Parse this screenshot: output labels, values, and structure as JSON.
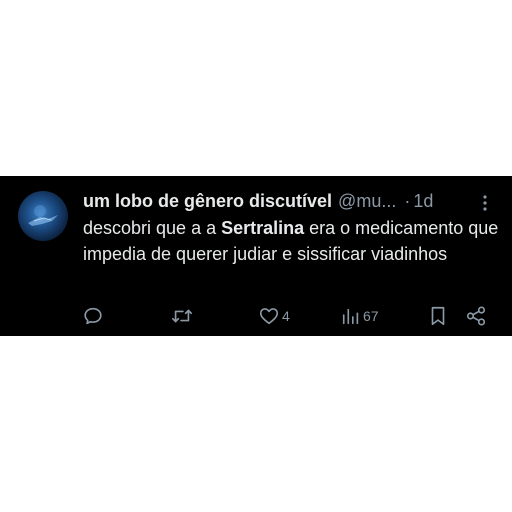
{
  "tweet": {
    "author_name": "um lobo de gênero discutível",
    "handle": "@mu...",
    "separator": "·",
    "time": "1d",
    "text_before": "descobri que a a ",
    "text_bold": "Sertralina",
    "text_after": " era o medicamento que impedia de querer judiar e sissificar viadinhos"
  },
  "actions": {
    "reply_icon": "reply-bubble-icon",
    "retweet_icon": "retweet-icon",
    "like_icon": "heart-icon",
    "like_count": "4",
    "views_icon": "bar-chart-icon",
    "views_count": "67",
    "bookmark_icon": "bookmark-icon",
    "share_icon": "share-icon"
  },
  "colors": {
    "background": "#000000",
    "page": "#ffffff",
    "text": "#e7e9ea",
    "muted": "#8b98a5"
  }
}
